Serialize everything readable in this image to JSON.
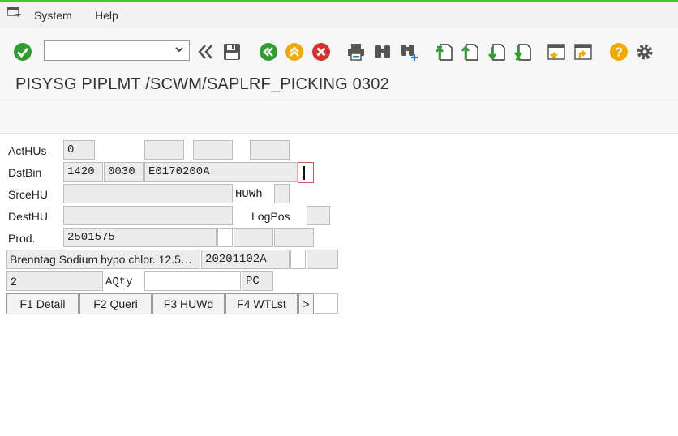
{
  "menubar": {
    "items": [
      "System",
      "Help"
    ]
  },
  "toolbar": {
    "command_field": {
      "value": "",
      "placeholder": ""
    },
    "icons": [
      "enter-icon",
      "back-double-icon",
      "save-icon",
      "back-icon",
      "exit-icon",
      "cancel-icon",
      "print-icon",
      "find-icon",
      "find-next-icon",
      "first-page-icon",
      "previous-page-icon",
      "next-page-icon",
      "last-page-icon",
      "create-session-icon",
      "generate-shortcut-icon",
      "help-icon",
      "settings-icon"
    ]
  },
  "title": "PISYSG PIPLMT /SCWM/SAPLRF_PICKING 0302",
  "form": {
    "acthus_label": "ActHUs",
    "acthus_value": "0",
    "dstbin_label": "DstBin",
    "dstbin_values": [
      "1420",
      "0030",
      "E0170200A"
    ],
    "srcehu_label": "SrceHU",
    "huwh_label": "HUWh",
    "desthu_label": "DestHU",
    "logpos_label": "LogPos",
    "prod_label": "Prod.",
    "prod_value": "2501575",
    "description": "Brenntag Sodium hypo chlor. 12.5…",
    "batch": "20201102A",
    "quantity": "2",
    "aqty_label": "AQty",
    "aqty_value": "",
    "unit": "PC"
  },
  "buttons": {
    "f1": "F1 Detail",
    "f2": "F2 Queri",
    "f3": "F3 HUWd",
    "f4": "F4 WTLst",
    "more": ">"
  },
  "colors": {
    "accent_green": "#3ccf2e",
    "ok_green": "#2e9e2e",
    "warn_yellow": "#f2a900",
    "cancel_red": "#d9302c"
  }
}
